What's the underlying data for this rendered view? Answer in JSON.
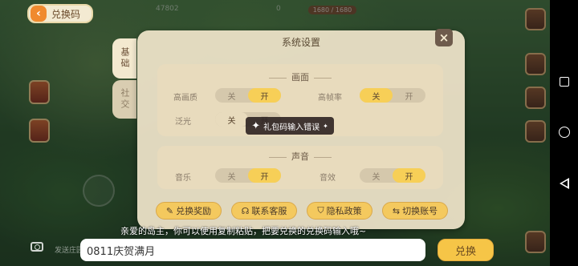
{
  "top_badge": {
    "label": "兑换码"
  },
  "hud": {
    "value1": "47802",
    "value2": "0",
    "hp": "1680 / 1680"
  },
  "dialog": {
    "title": "系统设置",
    "tabs": [
      {
        "label": "基础",
        "active": true
      },
      {
        "label": "社交",
        "active": false
      }
    ],
    "graphics": {
      "title": "画面",
      "rows": [
        {
          "label": "高画质",
          "off": "关",
          "on": "开",
          "value": "on"
        },
        {
          "label": "高帧率",
          "off": "关",
          "on": "开",
          "value": "off"
        },
        {
          "label": "泛光",
          "off": "关",
          "on": "开",
          "value": "off"
        }
      ]
    },
    "sound": {
      "title": "声音",
      "rows": [
        {
          "label": "音乐",
          "off": "关",
          "on": "开",
          "value": "on"
        },
        {
          "label": "音效",
          "off": "关",
          "on": "开",
          "value": "on"
        }
      ]
    },
    "actions": [
      {
        "label": "兑换奖励",
        "icon": "pencil-icon"
      },
      {
        "label": "联系客服",
        "icon": "headset-icon"
      },
      {
        "label": "隐私政策",
        "icon": "shield-icon"
      },
      {
        "label": "切换账号",
        "icon": "switch-icon"
      }
    ]
  },
  "toast": {
    "text": "礼包码输入错误"
  },
  "hint": "亲爱的岛主，你可以使用复制粘贴，把要兑换的兑换码输入哦~",
  "redeem_input": {
    "value": "0811庆贺满月"
  },
  "submit_button": {
    "label": "兑换"
  },
  "friend_label": "发送庄园",
  "colors": {
    "dialog_bg": "#f1e6cc",
    "toggle_on": "#f7cf57",
    "button": "#f4c95e"
  }
}
